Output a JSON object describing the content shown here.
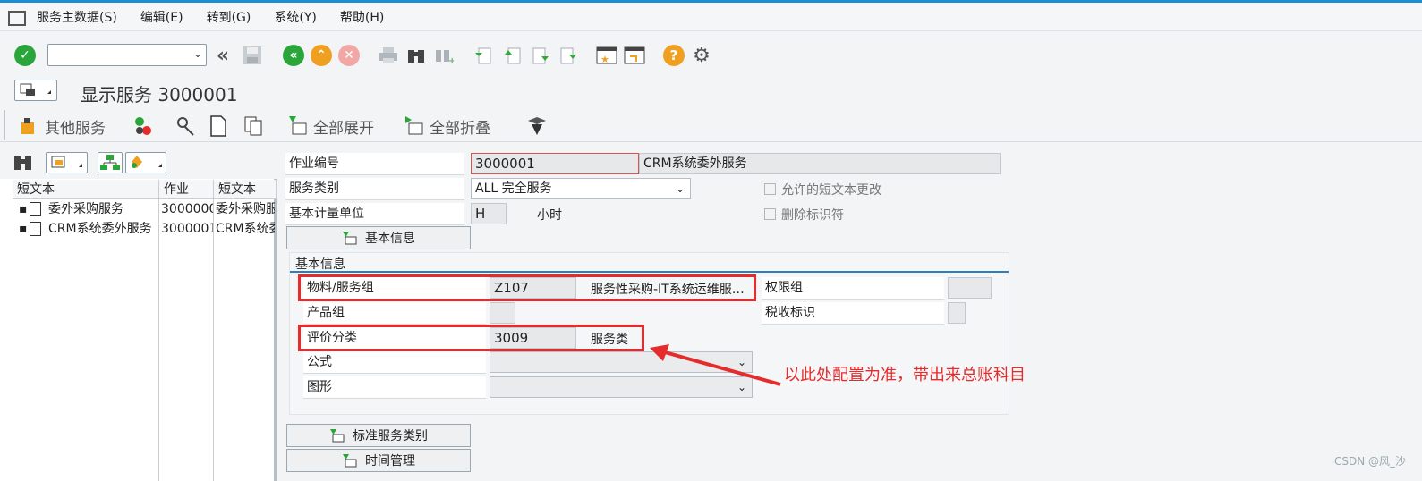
{
  "menu": [
    "服务主数据(S)",
    "编辑(E)",
    "转到(G)",
    "系统(Y)",
    "帮助(H)"
  ],
  "title": "显示服务 3000001",
  "app_toolbar": {
    "other_services": "其他服务",
    "expand_all": "全部展开",
    "collapse_all": "全部折叠"
  },
  "tree": {
    "headers": [
      "短文本",
      "作业",
      "短文本"
    ],
    "rows": [
      {
        "text": "委外采购服务",
        "job": "3000000",
        "short": "委外采购服"
      },
      {
        "text": "CRM系统委外服务",
        "job": "3000001",
        "short": "CRM系统委"
      }
    ]
  },
  "form": {
    "job_no_label": "作业编号",
    "job_no_value": "3000001",
    "job_desc": "CRM系统委外服务",
    "service_type_label": "服务类别",
    "service_type_value": "ALL 完全服务",
    "unit_label": "基本计量单位",
    "unit_value": "H",
    "unit_text": "小时",
    "allow_short_text": "允许的短文本更改",
    "delete_flag": "删除标识符",
    "basic_info_button": "基本信息",
    "basic_info_group": "基本信息",
    "material_group_label": "物料/服务组",
    "material_group_value": "Z107",
    "material_group_desc": "服务性采购-IT系统运维服…",
    "auth_group_label": "权限组",
    "product_group_label": "产品组",
    "tax_label": "税收标识",
    "valuation_label": "评价分类",
    "valuation_value": "3009",
    "valuation_desc": "服务类",
    "formula_label": "公式",
    "graphic_label": "图形",
    "std_service_button": "标准服务类别",
    "time_mgmt_button": "时间管理"
  },
  "annotation": "以此处配置为准，带出来总账科目",
  "watermark": "CSDN @风_沙",
  "colors": {
    "accent": "#1a8fd6",
    "green": "#2aa53a",
    "orange": "#f0a020",
    "red": "#e52b2b"
  }
}
